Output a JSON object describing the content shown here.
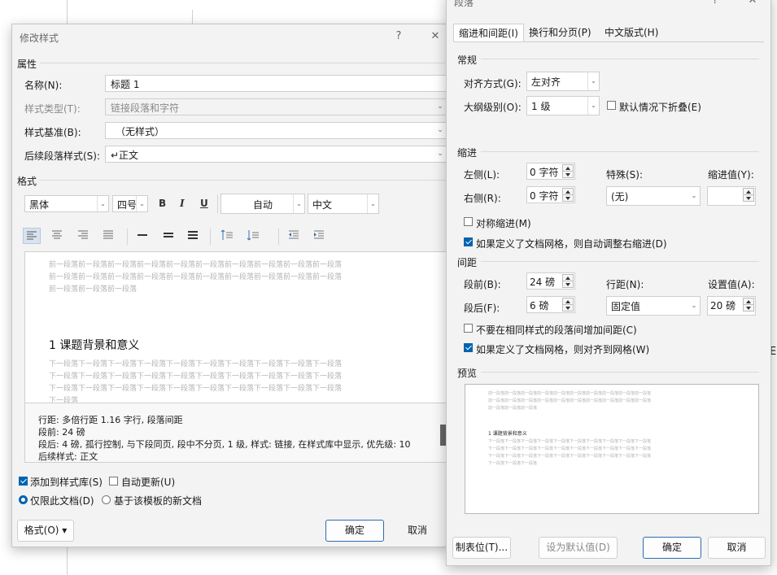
{
  "background": {
    "stray_text": "E"
  },
  "modify_style": {
    "title": "修改样式",
    "help_icon": "?",
    "close_icon": "✕",
    "properties_header": "属性",
    "name_label": "名称(N):",
    "name_value": "标题 1",
    "style_type_label": "样式类型(T):",
    "style_type_value": "链接段落和字符",
    "style_based_label": "样式基准(B):",
    "style_based_value": "（无样式）",
    "next_style_label": "后续段落样式(S):",
    "next_style_value": "↵正文",
    "format_header": "格式",
    "font": "黑体",
    "size": "四号",
    "bold": "B",
    "italic": "I",
    "underline": "U",
    "color": "自动",
    "lang": "中文",
    "preview_before_lines": [
      "前一段落前一段落前一段落前一段落前一段落前一段落前一段落前一段落前一段落前一段落",
      "前一段落前一段落前一段落前一段落前一段落前一段落前一段落前一段落前一段落前一段落",
      "前一段落前一段落前一段落"
    ],
    "preview_heading": "1 课题背景和意义",
    "preview_after_lines": [
      "下一段落下一段落下一段落下一段落下一段落下一段落下一段落下一段落下一段落下一段落",
      "下一段落下一段落下一段落下一段落下一段落下一段落下一段落下一段落下一段落下一段落",
      "下一段落下一段落下一段落下一段落下一段落下一段落下一段落下一段落下一段落下一段落",
      "下一段落"
    ],
    "description_lines": [
      "行距: 多倍行距 1.16 字行, 段落间距",
      "段前: 24 磅",
      "段后: 4 磅, 孤行控制, 与下段同页, 段中不分页, 1 级, 样式: 链接, 在样式库中显示, 优先级: 10",
      "后续样式: 正文"
    ],
    "add_to_gallery": "添加到样式库(S)",
    "auto_update": "自动更新(U)",
    "only_this_doc": "仅限此文档(D)",
    "template_docs": "基于该模板的新文档",
    "format_button": "格式(O) ▾",
    "ok": "确定",
    "cancel": "取消"
  },
  "paragraph": {
    "title": "段落",
    "help_icon": "?",
    "close_icon": "✕",
    "tabs": [
      "缩进和间距(I)",
      "换行和分页(P)",
      "中文版式(H)"
    ],
    "general_header": "常规",
    "alignment_label": "对齐方式(G):",
    "alignment_value": "左对齐",
    "outline_label": "大纲级别(O):",
    "outline_value": "1 级",
    "collapse_label": "默认情况下折叠(E)",
    "indent_header": "缩进",
    "left_label": "左侧(L):",
    "left_value": "0 字符",
    "right_label": "右侧(R):",
    "right_value": "0 字符",
    "special_label": "特殊(S):",
    "special_value": "(无)",
    "indent_by_label": "缩进值(Y):",
    "indent_by_value": "",
    "mirror_label": "对称缩进(M)",
    "auto_adjust_label": "如果定义了文档网格，则自动调整右缩进(D)",
    "spacing_header": "间距",
    "before_label": "段前(B):",
    "before_value": "24 磅",
    "after_label": "段后(F):",
    "after_value": "6 磅",
    "line_spacing_label": "行距(N):",
    "line_spacing_value": "固定值",
    "at_label": "设置值(A):",
    "at_value": "20 磅",
    "no_space_label": "不要在相同样式的段落间增加间距(C)",
    "snap_grid_label": "如果定义了文档网格，则对齐到网格(W)",
    "preview_header": "预览",
    "preview_before": [
      "前一段落前一段落前一段落前一段落前一段落前一段落前一段落前一段落前一段落前一段落",
      "前一段落前一段落前一段落前一段落前一段落前一段落前一段落前一段落前一段落前一段落",
      "前一段落前一段落前一段落"
    ],
    "preview_heading": "1 课题背景和意义",
    "preview_after": [
      "下一段落下一段落下一段落下一段落下一段落下一段落下一段落下一段落下一段落下一段落",
      "下一段落下一段落下一段落下一段落下一段落下一段落下一段落下一段落下一段落下一段落",
      "下一段落下一段落下一段落下一段落下一段落下一段落下一段落下一段落下一段落下一段落",
      "下一段落下一段落下一段落"
    ],
    "tabs_button": "制表位(T)...",
    "default_button": "设为默认值(D)",
    "ok": "确定",
    "cancel": "取消"
  }
}
